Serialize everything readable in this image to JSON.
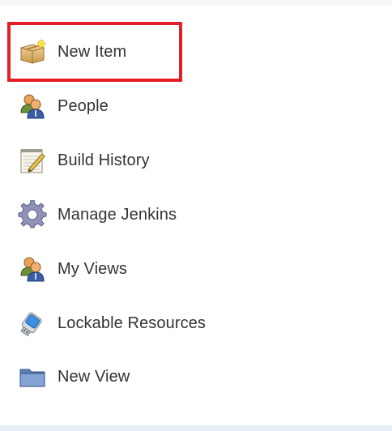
{
  "sidebar": {
    "items": [
      {
        "label": "New Item",
        "icon": "new-package-icon"
      },
      {
        "label": "People",
        "icon": "user-group-icon"
      },
      {
        "label": "Build History",
        "icon": "notepad-icon"
      },
      {
        "label": "Manage Jenkins",
        "icon": "gear-icon"
      },
      {
        "label": "My Views",
        "icon": "user-group-icon"
      },
      {
        "label": "Lockable Resources",
        "icon": "usb-drive-icon"
      },
      {
        "label": "New View",
        "icon": "folder-icon"
      }
    ]
  },
  "highlight": {
    "color": "#e41e26",
    "target": "New Item"
  }
}
